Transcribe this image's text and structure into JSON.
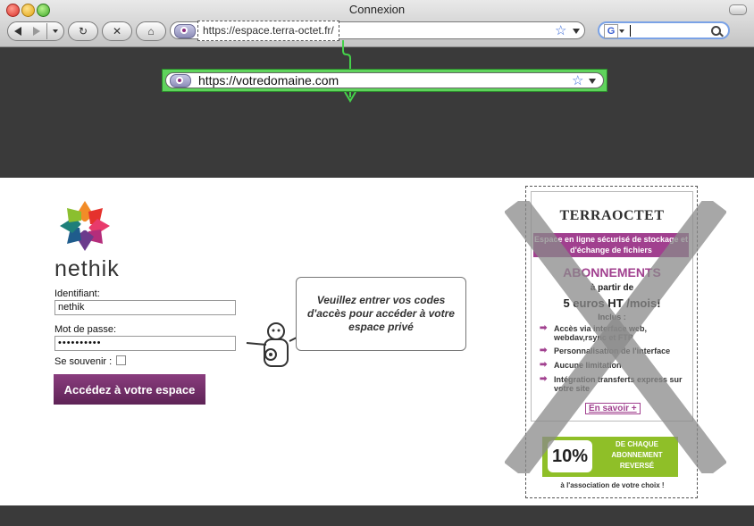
{
  "window": {
    "title": "Connexion"
  },
  "toolbar": {
    "address_url": "https://espace.terra-octet.fr/",
    "new_address_url": "https://votredomaine.com",
    "search_value": ""
  },
  "login": {
    "logo_text": "nethik",
    "username_label": "Identifiant:",
    "username_value": "nethik",
    "password_label": "Mot de passe:",
    "password_value": "••••••••••",
    "remember_label": "Se souvenir :",
    "submit_label": "Accédez à votre espace",
    "bubble_text": "Veuillez entrer vos codes d'accès pour accéder à votre espace privé"
  },
  "ad": {
    "logo": "TERRAOCTET",
    "band": "Espace en ligne sécurisé de stockage et d'échange de fichiers",
    "title": "ABONNEMENTS",
    "from_label": "à partir de",
    "price": "5 euros HT /mois!",
    "includes_label": "Inclus :",
    "features": [
      "Accès via interface web, webdav,rsync et FTP",
      "Personnalisation de l'interface",
      "Aucune limitation",
      "Intégration transferts express sur votre site"
    ],
    "link": "En savoir +",
    "badge_percent": "10%",
    "badge_text": "DE CHAQUE ABONNEMENT REVERSÉ",
    "footer": "à l'association de votre choix !"
  },
  "colors": {
    "brand_purple": "#a1408f",
    "button_purple": "#6e2d66",
    "badge_green": "#8fbf28",
    "highlight_green": "#5fd35c",
    "dark_band": "#3a3a3a"
  }
}
